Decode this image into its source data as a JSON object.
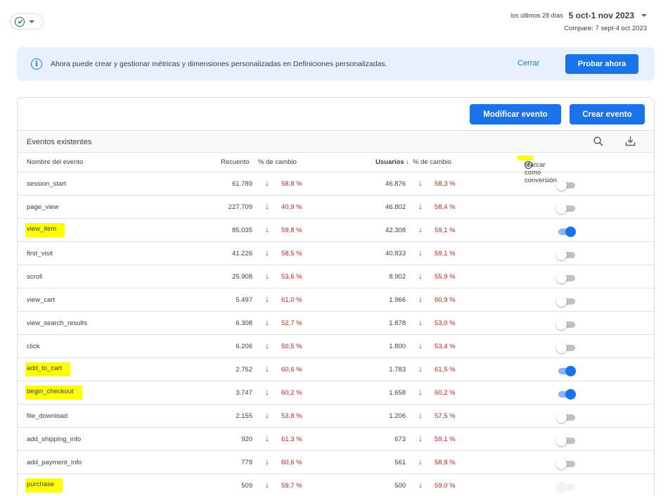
{
  "date": {
    "prefix": "los últimos 28 días",
    "range": "5 oct-1 nov 2023",
    "compare": "Compare: 7 sept-4 oct 2023"
  },
  "banner": {
    "info_symbol": "i",
    "text": "Ahora puede crear y gestionar métricas y dimensiones personalizadas en Definiciones personalizadas.",
    "close_label": "Cerrar",
    "try_label": "Probar ahora"
  },
  "toolbar": {
    "modify_label": "Modificar evento",
    "create_label": "Crear evento"
  },
  "table": {
    "title": "Eventos existentes",
    "columns": {
      "name": "Nombre del evento",
      "count": "Recuento",
      "pct1": "% de cambio",
      "users": "Usuarios ↓",
      "pct2": "% de cambio",
      "conversion": "Marcar como conversión",
      "help_symbol": "?"
    },
    "down_arrow": "↓",
    "rows": [
      {
        "name": "session_start",
        "count": "61.789",
        "pct1": "58,8 %",
        "users": "46.876",
        "pct2": "58,3 %",
        "conversion": false,
        "highlight": false
      },
      {
        "name": "page_view",
        "count": "227.709",
        "pct1": "40,9 %",
        "users": "46.802",
        "pct2": "58,4 %",
        "conversion": false,
        "highlight": false
      },
      {
        "name": "view_item",
        "count": "85.035",
        "pct1": "59,8 %",
        "users": "42.308",
        "pct2": "59,1 %",
        "conversion": true,
        "highlight": true
      },
      {
        "name": "first_visit",
        "count": "41.226",
        "pct1": "58,5 %",
        "users": "40.833",
        "pct2": "59,1 %",
        "conversion": false,
        "highlight": false
      },
      {
        "name": "scroll",
        "count": "25.908",
        "pct1": "53,6 %",
        "users": "8.902",
        "pct2": "55,9 %",
        "conversion": false,
        "highlight": false
      },
      {
        "name": "view_cart",
        "count": "5.497",
        "pct1": "61,0 %",
        "users": "1.966",
        "pct2": "60,9 %",
        "conversion": false,
        "highlight": false
      },
      {
        "name": "view_search_results",
        "count": "6.308",
        "pct1": "52,7 %",
        "users": "1.878",
        "pct2": "53,0 %",
        "conversion": false,
        "highlight": false
      },
      {
        "name": "click",
        "count": "6.206",
        "pct1": "50,5 %",
        "users": "1.800",
        "pct2": "53,4 %",
        "conversion": false,
        "highlight": false
      },
      {
        "name": "add_to_cart",
        "count": "2.752",
        "pct1": "60,6 %",
        "users": "1.783",
        "pct2": "61,5 %",
        "conversion": true,
        "highlight": true
      },
      {
        "name": "begin_checkout",
        "count": "3.747",
        "pct1": "60,2 %",
        "users": "1.658",
        "pct2": "60,2 %",
        "conversion": true,
        "highlight": true
      },
      {
        "name": "file_download",
        "count": "2.155",
        "pct1": "53,8 %",
        "users": "1.206",
        "pct2": "57,5 %",
        "conversion": false,
        "highlight": false
      },
      {
        "name": "add_shipping_info",
        "count": "920",
        "pct1": "61,3 %",
        "users": "673",
        "pct2": "59,1 %",
        "conversion": false,
        "highlight": false
      },
      {
        "name": "add_payment_info",
        "count": "779",
        "pct1": "60,6 %",
        "users": "561",
        "pct2": "58,8 %",
        "conversion": false,
        "highlight": false
      },
      {
        "name": "purchase",
        "count": "509",
        "pct1": "59,7 %",
        "users": "500",
        "pct2": "59,0 %",
        "conversion": false,
        "highlight": true,
        "faint": true
      }
    ]
  },
  "colors": {
    "accent": "#1a73e8",
    "negative": "#c5221f",
    "highlight": "#ffff00",
    "banner_bg": "#e8f0fe"
  }
}
